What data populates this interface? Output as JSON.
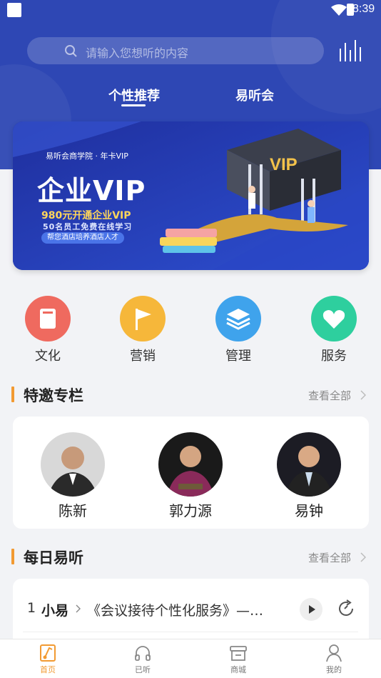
{
  "status_bar": {
    "time": "8:39"
  },
  "search": {
    "placeholder": "请输入您想听的内容"
  },
  "tabs": [
    {
      "label": "个性推荐",
      "active": true
    },
    {
      "label": "易听会",
      "active": false
    }
  ],
  "banner": {
    "subtitle": "易听会商学院 · 年卡VIP",
    "title": "企业VIP",
    "line1": "980元开通企业VIP",
    "line2": "50名员工免费在线学习",
    "pill": "帮您酒店培养酒店人才",
    "artwork_text": "VIP"
  },
  "categories": [
    {
      "label": "文化",
      "icon": "book-icon",
      "color": "#ef6a5f"
    },
    {
      "label": "营销",
      "icon": "flag-icon",
      "color": "#f6b73a"
    },
    {
      "label": "管理",
      "icon": "layers-icon",
      "color": "#3fa3ec"
    },
    {
      "label": "服务",
      "icon": "heart-icon",
      "color": "#2ecf9e"
    }
  ],
  "featured": {
    "title": "特邀专栏",
    "more": "查看全部",
    "lecturers": [
      {
        "name": "陈新"
      },
      {
        "name": "郭力源"
      },
      {
        "name": "易钟"
      }
    ]
  },
  "daily": {
    "title": "每日易听",
    "more": "查看全部",
    "items": [
      {
        "index": "1",
        "author": "小易",
        "title": "《会议接待个性化服务》—…"
      }
    ]
  },
  "bottom_nav": [
    {
      "label": "首页",
      "icon": "home-music-icon",
      "active": true
    },
    {
      "label": "已听",
      "icon": "headphones-icon",
      "active": false
    },
    {
      "label": "商城",
      "icon": "store-icon",
      "active": false
    },
    {
      "label": "我的",
      "icon": "user-icon",
      "active": false
    }
  ],
  "colors": {
    "primary": "#2e47b4",
    "accent": "#f29a32"
  }
}
